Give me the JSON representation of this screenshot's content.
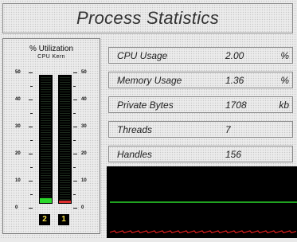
{
  "window": {
    "title": "Process Statistics"
  },
  "utilization": {
    "title": "% Utilization",
    "column_labels": "CPU  Kern",
    "scale_ticks": [
      "50",
      "40",
      "30",
      "20",
      "10",
      "0"
    ],
    "cpu": {
      "percent": 2
    },
    "kernel": {
      "percent": 1
    },
    "cpu_counter": "2",
    "kernel_counter": "1"
  },
  "stats": {
    "rows": [
      {
        "label": "CPU Usage",
        "value": "2.00",
        "unit": "%"
      },
      {
        "label": "Memory Usage",
        "value": "1.36",
        "unit": "%"
      },
      {
        "label": "Private Bytes",
        "value": "1708",
        "unit": "kb"
      },
      {
        "label": "Threads",
        "value": "7",
        "unit": ""
      },
      {
        "label": "Handles",
        "value": "156",
        "unit": ""
      }
    ]
  },
  "graph": {
    "cpu_line_color": "#2bd82b",
    "kernel_line_color": "#e02020",
    "cpu_level_percent": 50,
    "kernel_level_percent": 2
  },
  "colors": {
    "background": "#ececec",
    "counter_text": "#f6e04a"
  }
}
